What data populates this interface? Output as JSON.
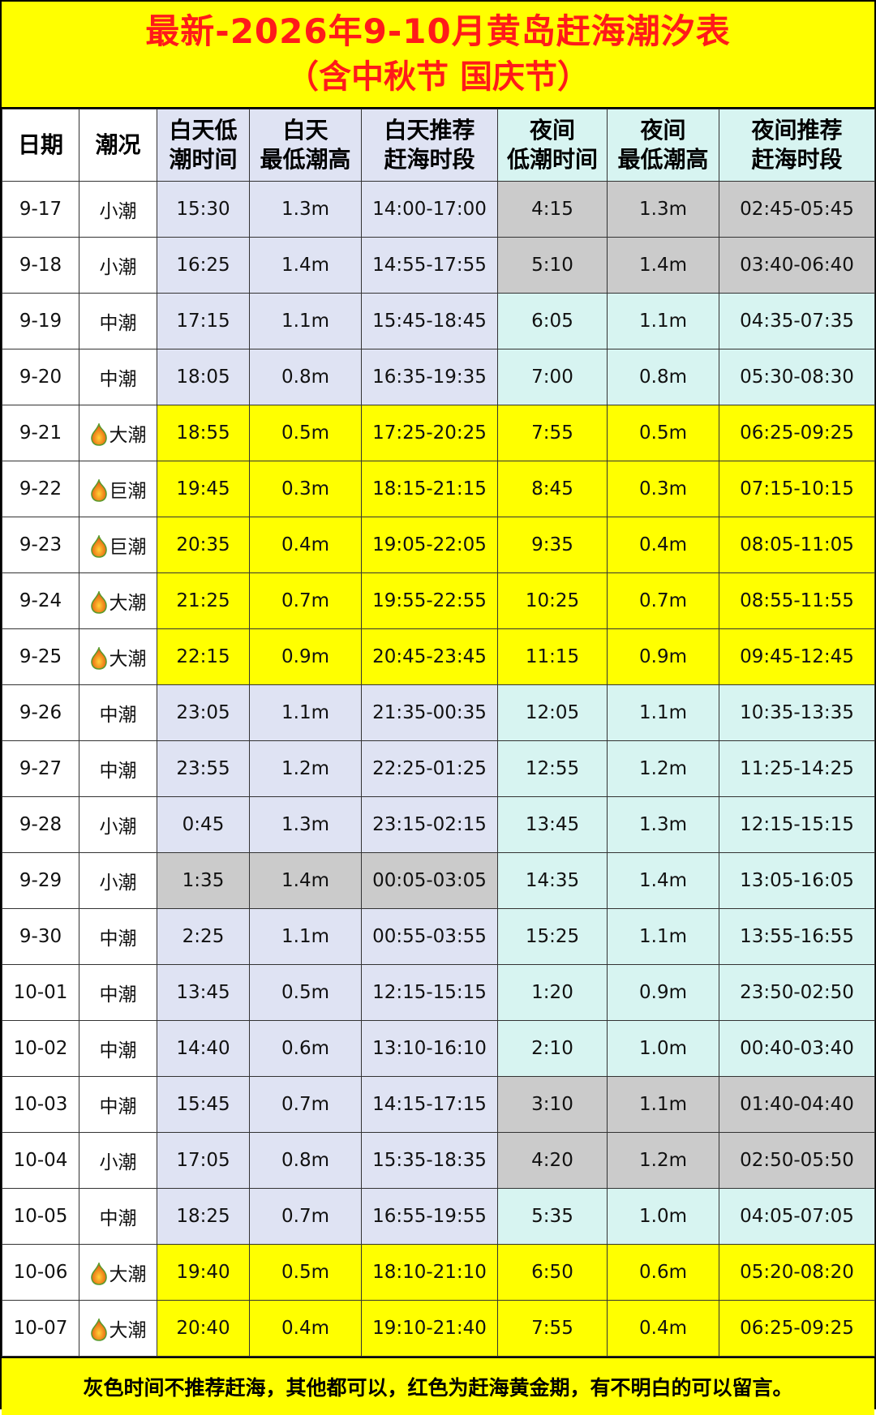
{
  "title": {
    "line1": "最新-2026年9-10月黄岛赶海潮汐表",
    "line2": "（含中秋节  国庆节）"
  },
  "headers": [
    "日期",
    "潮况",
    "白天低\n潮时间",
    "白天\n最低潮高",
    "白天推荐\n赶海时段",
    "夜间\n低潮时间",
    "夜间\n最低潮高",
    "夜间推荐\n赶海时段"
  ],
  "colors": {
    "yellow": "#ffff00",
    "gray": "#cbcbcb",
    "day_blue": "#dfe3f3",
    "night_cyan": "#d7f4f1",
    "title_red": "#ff1a1a"
  },
  "rows": [
    {
      "date": "9-17",
      "tide": "小潮",
      "flame": false,
      "day_time": "15:30",
      "day_h": "1.3m",
      "day_slot": "14:00-17:00",
      "night_time": "4:15",
      "night_h": "1.3m",
      "night_slot": "02:45-05:45",
      "day_color": "blue",
      "night_color": "gray"
    },
    {
      "date": "9-18",
      "tide": "小潮",
      "flame": false,
      "day_time": "16:25",
      "day_h": "1.4m",
      "day_slot": "14:55-17:55",
      "night_time": "5:10",
      "night_h": "1.4m",
      "night_slot": "03:40-06:40",
      "day_color": "blue",
      "night_color": "gray"
    },
    {
      "date": "9-19",
      "tide": "中潮",
      "flame": false,
      "day_time": "17:15",
      "day_h": "1.1m",
      "day_slot": "15:45-18:45",
      "night_time": "6:05",
      "night_h": "1.1m",
      "night_slot": "04:35-07:35",
      "day_color": "blue",
      "night_color": "cyan"
    },
    {
      "date": "9-20",
      "tide": "中潮",
      "flame": false,
      "day_time": "18:05",
      "day_h": "0.8m",
      "day_slot": "16:35-19:35",
      "night_time": "7:00",
      "night_h": "0.8m",
      "night_slot": "05:30-08:30",
      "day_color": "blue",
      "night_color": "cyan"
    },
    {
      "date": "9-21",
      "tide": "大潮",
      "flame": true,
      "day_time": "18:55",
      "day_h": "0.5m",
      "day_slot": "17:25-20:25",
      "night_time": "7:55",
      "night_h": "0.5m",
      "night_slot": "06:25-09:25",
      "day_color": "yellow",
      "night_color": "yellow"
    },
    {
      "date": "9-22",
      "tide": "巨潮",
      "flame": true,
      "day_time": "19:45",
      "day_h": "0.3m",
      "day_slot": "18:15-21:15",
      "night_time": "8:45",
      "night_h": "0.3m",
      "night_slot": "07:15-10:15",
      "day_color": "yellow",
      "night_color": "yellow"
    },
    {
      "date": "9-23",
      "tide": "巨潮",
      "flame": true,
      "day_time": "20:35",
      "day_h": "0.4m",
      "day_slot": "19:05-22:05",
      "night_time": "9:35",
      "night_h": "0.4m",
      "night_slot": "08:05-11:05",
      "day_color": "yellow",
      "night_color": "yellow"
    },
    {
      "date": "9-24",
      "tide": "大潮",
      "flame": true,
      "day_time": "21:25",
      "day_h": "0.7m",
      "day_slot": "19:55-22:55",
      "night_time": "10:25",
      "night_h": "0.7m",
      "night_slot": "08:55-11:55",
      "day_color": "yellow",
      "night_color": "yellow"
    },
    {
      "date": "9-25",
      "tide": "大潮",
      "flame": true,
      "day_time": "22:15",
      "day_h": "0.9m",
      "day_slot": "20:45-23:45",
      "night_time": "11:15",
      "night_h": "0.9m",
      "night_slot": "09:45-12:45",
      "day_color": "yellow",
      "night_color": "yellow"
    },
    {
      "date": "9-26",
      "tide": "中潮",
      "flame": false,
      "day_time": "23:05",
      "day_h": "1.1m",
      "day_slot": "21:35-00:35",
      "night_time": "12:05",
      "night_h": "1.1m",
      "night_slot": "10:35-13:35",
      "day_color": "blue",
      "night_color": "cyan"
    },
    {
      "date": "9-27",
      "tide": "中潮",
      "flame": false,
      "day_time": "23:55",
      "day_h": "1.2m",
      "day_slot": "22:25-01:25",
      "night_time": "12:55",
      "night_h": "1.2m",
      "night_slot": "11:25-14:25",
      "day_color": "blue",
      "night_color": "cyan"
    },
    {
      "date": "9-28",
      "tide": "小潮",
      "flame": false,
      "day_time": "0:45",
      "day_h": "1.3m",
      "day_slot": "23:15-02:15",
      "night_time": "13:45",
      "night_h": "1.3m",
      "night_slot": "12:15-15:15",
      "day_color": "blue",
      "night_color": "cyan"
    },
    {
      "date": "9-29",
      "tide": "小潮",
      "flame": false,
      "day_time": "1:35",
      "day_h": "1.4m",
      "day_slot": "00:05-03:05",
      "night_time": "14:35",
      "night_h": "1.4m",
      "night_slot": "13:05-16:05",
      "day_color": "gray",
      "night_color": "cyan"
    },
    {
      "date": "9-30",
      "tide": "中潮",
      "flame": false,
      "day_time": "2:25",
      "day_h": "1.1m",
      "day_slot": "00:55-03:55",
      "night_time": "15:25",
      "night_h": "1.1m",
      "night_slot": "13:55-16:55",
      "day_color": "blue",
      "night_color": "cyan"
    },
    {
      "date": "10-01",
      "tide": "中潮",
      "flame": false,
      "day_time": "13:45",
      "day_h": "0.5m",
      "day_slot": "12:15-15:15",
      "night_time": "1:20",
      "night_h": "0.9m",
      "night_slot": "23:50-02:50",
      "day_color": "blue",
      "night_color": "cyan"
    },
    {
      "date": "10-02",
      "tide": "中潮",
      "flame": false,
      "day_time": "14:40",
      "day_h": "0.6m",
      "day_slot": "13:10-16:10",
      "night_time": "2:10",
      "night_h": "1.0m",
      "night_slot": "00:40-03:40",
      "day_color": "blue",
      "night_color": "cyan"
    },
    {
      "date": "10-03",
      "tide": "中潮",
      "flame": false,
      "day_time": "15:45",
      "day_h": "0.7m",
      "day_slot": "14:15-17:15",
      "night_time": "3:10",
      "night_h": "1.1m",
      "night_slot": "01:40-04:40",
      "day_color": "blue",
      "night_color": "gray"
    },
    {
      "date": "10-04",
      "tide": "小潮",
      "flame": false,
      "day_time": "17:05",
      "day_h": "0.8m",
      "day_slot": "15:35-18:35",
      "night_time": "4:20",
      "night_h": "1.2m",
      "night_slot": "02:50-05:50",
      "day_color": "blue",
      "night_color": "gray"
    },
    {
      "date": "10-05",
      "tide": "中潮",
      "flame": false,
      "day_time": "18:25",
      "day_h": "0.7m",
      "day_slot": "16:55-19:55",
      "night_time": "5:35",
      "night_h": "1.0m",
      "night_slot": "04:05-07:05",
      "day_color": "blue",
      "night_color": "cyan"
    },
    {
      "date": "10-06",
      "tide": "大潮",
      "flame": true,
      "day_time": "19:40",
      "day_h": "0.5m",
      "day_slot": "18:10-21:10",
      "night_time": "6:50",
      "night_h": "0.6m",
      "night_slot": "05:20-08:20",
      "day_color": "yellow",
      "night_color": "yellow"
    },
    {
      "date": "10-07",
      "tide": "大潮",
      "flame": true,
      "day_time": "20:40",
      "day_h": "0.4m",
      "day_slot": "19:10-21:40",
      "night_time": "7:55",
      "night_h": "0.4m",
      "night_slot": "06:25-09:25",
      "day_color": "yellow",
      "night_color": "yellow"
    }
  ],
  "footer": "灰色时间不推荐赶海，其他都可以，红色为赶海黄金期，有不明白的可以留言。"
}
